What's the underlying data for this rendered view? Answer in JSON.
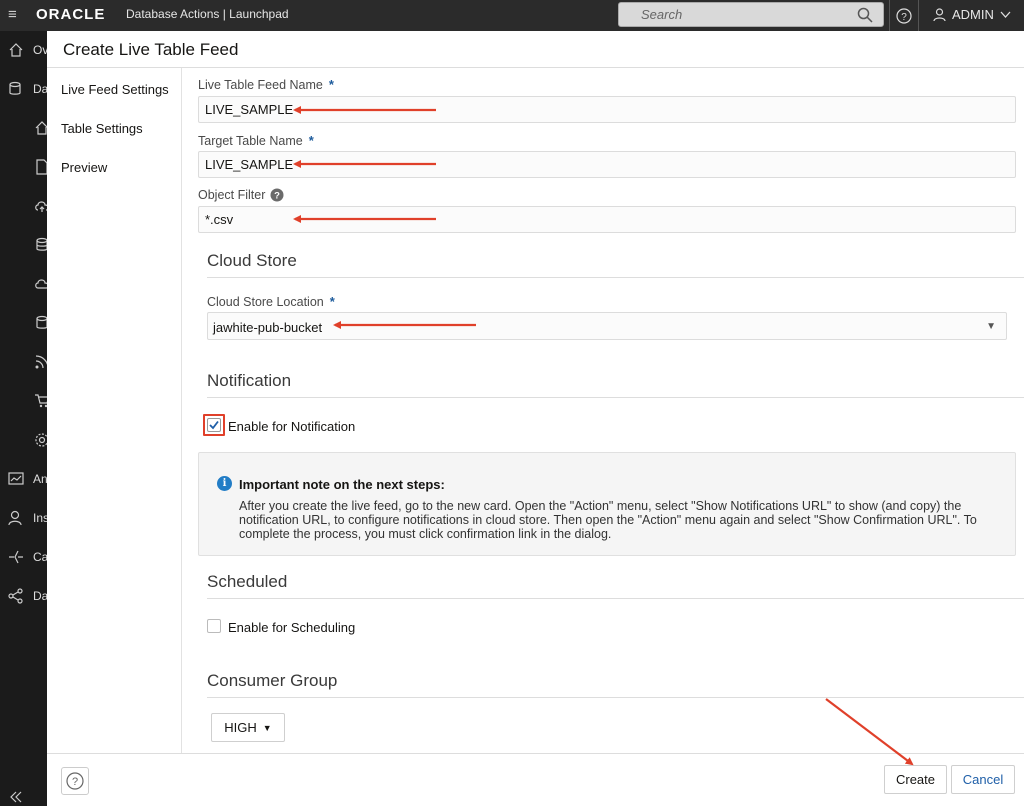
{
  "topbar": {
    "logo": "ORACLE",
    "app_title": "Database Actions | Launchpad",
    "search_placeholder": "Search",
    "user": "ADMIN"
  },
  "leftnav": {
    "items": [
      {
        "label": "Ov",
        "icon": "home-icon"
      },
      {
        "label": "Da",
        "icon": "database-edit-icon"
      },
      {
        "label": "An",
        "icon": "chart-icon"
      },
      {
        "label": "Ins",
        "icon": "user-icon"
      },
      {
        "label": "Ca",
        "icon": "catalog-icon"
      },
      {
        "label": "Da",
        "icon": "share-icon"
      }
    ]
  },
  "dialog": {
    "title": "Create Live Table Feed",
    "steps": [
      "Live Feed Settings",
      "Table Settings",
      "Preview"
    ],
    "fields": {
      "feed_name_label": "Live Table Feed Name",
      "feed_name_value": "LIVE_SAMPLE",
      "target_table_label": "Target Table Name",
      "target_table_value": "LIVE_SAMPLE",
      "object_filter_label": "Object Filter",
      "object_filter_value": "*.csv",
      "required_marker": "*"
    },
    "cloud_store": {
      "section_title": "Cloud Store",
      "location_label": "Cloud Store Location",
      "location_value": "jawhite-pub-bucket"
    },
    "notification": {
      "section_title": "Notification",
      "checkbox_label": "Enable for Notification",
      "checked": true,
      "note_title": "Important note on the next steps:",
      "note_body": "After you create the live feed, go to the new card. Open the \"Action\" menu, select \"Show Notifications URL\" to show (and copy) the notification URL, to configure notifications in cloud store. Then open the \"Action\" menu again and select \"Show Confirmation URL\". To complete the process, you must click confirmation link in the dialog."
    },
    "scheduled": {
      "section_title": "Scheduled",
      "checkbox_label": "Enable for Scheduling",
      "checked": false
    },
    "consumer_group": {
      "section_title": "Consumer Group",
      "value": "HIGH"
    },
    "footer": {
      "create_label": "Create",
      "cancel_label": "Cancel"
    }
  },
  "colors": {
    "annotation_arrow": "#e0402a",
    "accent_blue": "#1f5fa8"
  }
}
